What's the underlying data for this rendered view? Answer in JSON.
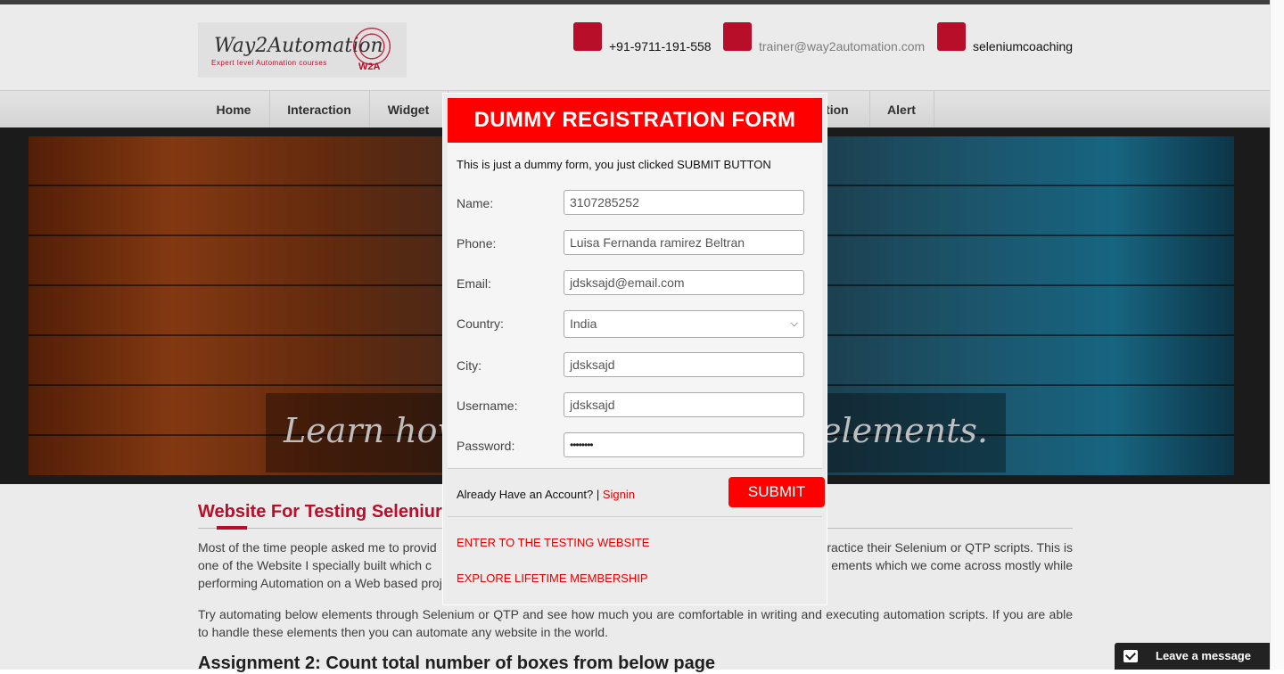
{
  "header": {
    "logo_title": "Way2Automation",
    "logo_tagline": "Expert level Automation courses",
    "logo_mark": "W2A",
    "phone": "+91-9711-191-558",
    "email": "trainer@way2automation.com",
    "skype": "seleniumcoaching"
  },
  "nav": {
    "items": [
      "Home",
      "Interaction",
      "Widget",
      "ation",
      "Alert"
    ]
  },
  "hero": {
    "caption_left": "Learn how",
    "caption_right": "webelements."
  },
  "content": {
    "section_title": "Website For Testing Seleniur",
    "para1_left": "Most of the time people asked me to provid",
    "para1_right": "ractice their Selenium or QTP scripts. This is",
    "para1_line2_left": "one of the Website I specially built which c",
    "para1_line2_right": "ements which we come across mostly while",
    "para1_line3": "performing Automation on a Web based proj",
    "para2": "Try automating below elements through Selenium or QTP and see how much you are comfortable in writing and executing automation scripts. If you are able to handle these elements then you can automate any website in the world.",
    "h2": "Assignment 2: Count total number of boxes from below page"
  },
  "modal": {
    "title": "DUMMY REGISTRATION FORM",
    "note": "This is just a dummy form, you just clicked SUBMIT BUTTON",
    "fields": {
      "name": {
        "label": "Name:",
        "value": "3107285252"
      },
      "phone": {
        "label": "Phone:",
        "value": "Luisa Fernanda ramirez Beltran"
      },
      "email": {
        "label": "Email:",
        "value": "jdsksajd@email.com"
      },
      "country": {
        "label": "Country:",
        "value": "India"
      },
      "city": {
        "label": "City:",
        "value": "jdsksajd"
      },
      "username": {
        "label": "Username:",
        "value": "jdsksajd"
      },
      "password": {
        "label": "Password:",
        "value": "••••••••"
      }
    },
    "already_text": "Already Have an Account? | ",
    "signin": "Signin",
    "submit": "SUBMIT",
    "link_testing": "ENTER TO THE TESTING WEBSITE",
    "link_membership": "EXPLORE LIFETIME MEMBERSHIP"
  },
  "chat": {
    "label": "Leave a message"
  }
}
